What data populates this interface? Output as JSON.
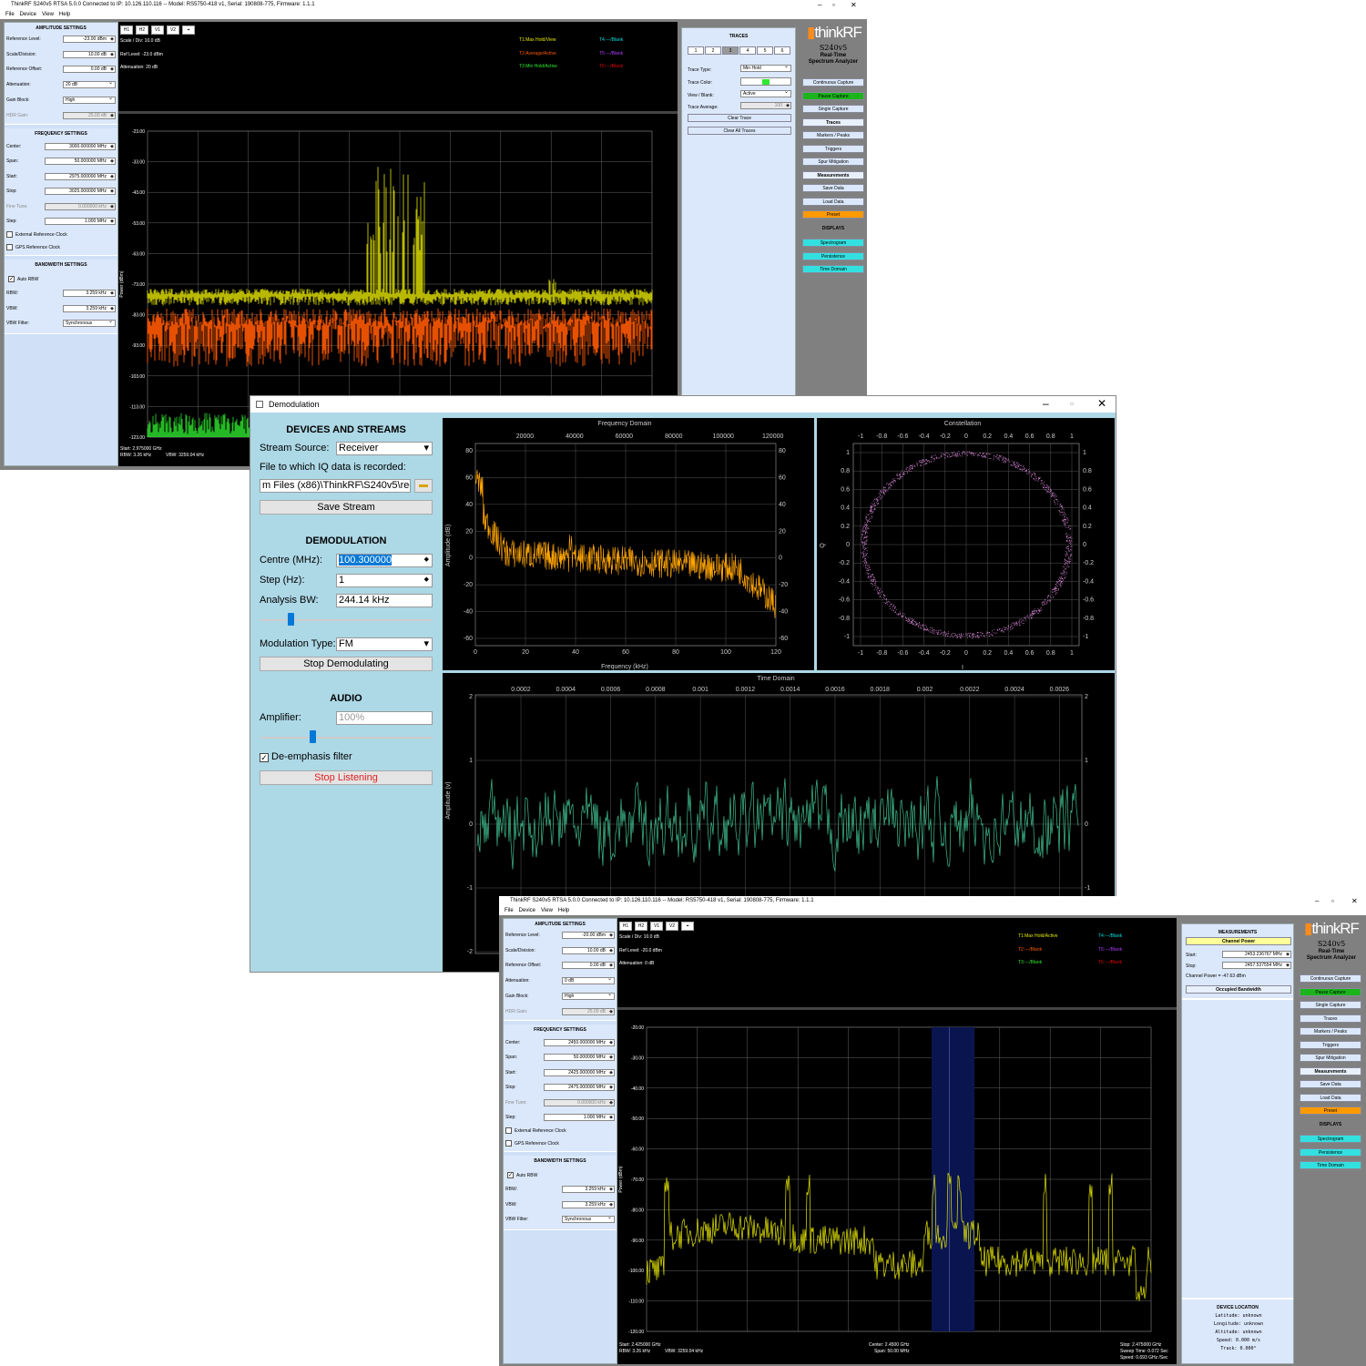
{
  "win1": {
    "title": "ThinkRF S240v5 RTSA 5.0.0 Connected to IP: 10.126.110.116 -- Model: RS5750-418 v1, Serial: 190808-775, Firmware: 1.1.1",
    "menu": [
      "File",
      "Device",
      "View",
      "Help"
    ],
    "amp": {
      "title": "AMPLITUDE SETTINGS",
      "ref_label": "Reference Level:",
      "ref": "-23.00 dBm",
      "scale_label": "Scale/Division:",
      "scale": "10.00 dB",
      "offset_label": "Reference Offset:",
      "offset": "0.00 dB",
      "att_label": "Attenuation:",
      "att": "20 dB",
      "gain_label": "Gain Block:",
      "gain": "High",
      "hdr_label": "HDR Gain:",
      "hdr": "25.00 dB"
    },
    "freq": {
      "title": "FREQUENCY SETTINGS",
      "center_label": "Center:",
      "center": "3000.000000 MHz",
      "span_label": "Span:",
      "span": "50.000000 MHz",
      "start_label": "Start:",
      "start": "2975.000000 MHz",
      "stop_label": "Stop:",
      "stop": "3025.000000 MHz",
      "fine_label": "Fine Tune:",
      "fine": "0.000000 kHz",
      "step_label": "Step:",
      "step": "1.000 MHz",
      "ext_clock": "External Reference Clock",
      "gps_clock": "GPS Reference Clock"
    },
    "bw": {
      "title": "BANDWIDTH SETTINGS",
      "auto": "Auto RBW",
      "rbw_label": "RBW:",
      "rbw": "3.259 kHz",
      "vbw_label": "VBW:",
      "vbw": "3.259 kHz",
      "filter_label": "VBW Filter:",
      "filter": "Synchronous"
    },
    "topbtns": [
      "H1",
      "H2",
      "V1",
      "V2",
      "⌖"
    ],
    "info": {
      "scale": "Scale / Div: 10.0 dB",
      "ref": "Ref Level: -23.0 dBm",
      "att": "Attenuation: 20 dB"
    },
    "legend": {
      "t1": "T1:Max Hold/View",
      "t2": "T2:Average/Active",
      "t3": "T3:Min Hold/Active",
      "t4": "T4:---/Blank",
      "t5": "T5:---/Blank",
      "t6": "T6:---/Blank"
    },
    "yticks": [
      "-23.00",
      "-33.00",
      "-43.00",
      "-53.00",
      "-63.00",
      "-73.00",
      "-83.00",
      "-93.00",
      "-103.00",
      "-113.00",
      "-123.00"
    ],
    "ylabel": "Power (dBm)",
    "footer": {
      "start": "Start: 2.975000 GHz",
      "rbw": "RBW: 3.26 kHz",
      "vbw": "VBW: 3259.04 kHz"
    },
    "traces": {
      "title": "TRACES",
      "tabs": [
        "1",
        "2",
        "3",
        "4",
        "5",
        "6"
      ],
      "type_label": "Trace Type:",
      "type": "Min Hold",
      "color_label": "Trace Color:",
      "view_label": "View / Blank:",
      "view": "Active",
      "avg_label": "Trace Average:",
      "avg": "100",
      "clear": "Clear Trace",
      "clear_all": "Clear All Traces"
    },
    "brand": {
      "logo": "thinkRF",
      "model": "S240v5",
      "sub1": "Real-Time",
      "sub2": "Spectrum Analyzer"
    },
    "side": [
      "Continuous Capture",
      "Pause Capture",
      "Single Capture",
      "Traces",
      "Markers / Peaks",
      "Triggers",
      "Spur Mitigation",
      "Measurements",
      "Save Data",
      "Load Data",
      "Preset"
    ],
    "displays_title": "DISPLAYS",
    "displays": [
      "Spectrogram",
      "Persistence",
      "Time Domain"
    ]
  },
  "demod": {
    "title": "Demodulation",
    "dev_title": "DEVICES AND STREAMS",
    "stream_label": "Stream Source:",
    "stream": "Receiver",
    "file_label": "File to which IQ data is recorded:",
    "file": "m Files (x86)\\ThinkRF\\S240v5\\recordings",
    "save": "Save Stream",
    "demod_title": "DEMODULATION",
    "centre_label": "Centre (MHz):",
    "centre": "100.300000",
    "step_label": "Step (Hz):",
    "step": "1",
    "abw_label": "Analysis BW:",
    "abw": "244.14 kHz",
    "mod_label": "Modulation Type:",
    "mod": "FM",
    "stop_demod": "Stop Demodulating",
    "audio_title": "AUDIO",
    "amp_label": "Amplifier:",
    "amp": "100%",
    "deemph": "De-emphasis filter",
    "stop_listen": "Stop Listening",
    "fd": {
      "title": "Frequency Domain",
      "xlabel": "Frequency (kHz)",
      "ylabel": "Amplitude (dB)",
      "top": [
        "20000",
        "40000",
        "60000",
        "80000",
        "100000",
        "120000"
      ],
      "bottom": [
        "0",
        "20",
        "40",
        "60",
        "80",
        "100",
        "120"
      ],
      "left": [
        "80",
        "60",
        "40",
        "20",
        "0",
        "-20",
        "-40",
        "-60"
      ],
      "right": [
        "80",
        "60",
        "40",
        "20",
        "0",
        "-20",
        "-40",
        "-60"
      ]
    },
    "con": {
      "title": "Constellation",
      "xlabel": "I",
      "ylabel": "Q",
      "x": [
        "-1",
        "-0.8",
        "-0.6",
        "-0.4",
        "-0.2",
        "0",
        "0.2",
        "0.4",
        "0.6",
        "0.8",
        "1"
      ],
      "y": [
        "1",
        "0.8",
        "0.6",
        "0.4",
        "0.2",
        "0",
        "-0.2",
        "-0.4",
        "-0.6",
        "-0.8",
        "-1"
      ]
    },
    "td": {
      "title": "Time Domain",
      "ylabel": "Amplitude (v)",
      "x": [
        "0.0002",
        "0.0004",
        "0.0006",
        "0.0008",
        "0.001",
        "0.0012",
        "0.0014",
        "0.0016",
        "0.0018",
        "0.002",
        "0.0022",
        "0.0024",
        "0.0026"
      ],
      "y": [
        "2",
        "1",
        "0",
        "-1",
        "-2"
      ]
    }
  },
  "win3": {
    "title": "ThinkRF S240v5 RTSA 5.0.0 Connected to IP: 10.126.110.116 -- Model: RS5750-418 v1, Serial: 190808-775, Firmware: 1.1.1",
    "menu": [
      "File",
      "Device",
      "View",
      "Help"
    ],
    "amp": {
      "title": "AMPLITUDE SETTINGS",
      "ref_label": "Reference Level:",
      "ref": "-20.00 dBm",
      "scale_label": "Scale/Division:",
      "scale": "10.00 dB",
      "offset_label": "Reference Offset:",
      "offset": "0.00 dB",
      "att_label": "Attenuation:",
      "att": "0 dB",
      "gain_label": "Gain Block:",
      "gain": "High",
      "hdr_label": "HDR Gain:",
      "hdr": "25.00 dB"
    },
    "freq": {
      "title": "FREQUENCY SETTINGS",
      "center_label": "Center:",
      "center": "2450.000000 MHz",
      "span_label": "Span:",
      "span": "50.000000 MHz",
      "start_label": "Start:",
      "start": "2425.000000 MHz",
      "stop_label": "Stop:",
      "stop": "2475.000000 MHz",
      "fine_label": "Fine Tune:",
      "fine": "0.000000 kHz",
      "step_label": "Step:",
      "step": "1.000 MHz",
      "ext_clock": "External Reference Clock",
      "gps_clock": "GPS Reference Clock"
    },
    "bw": {
      "title": "BANDWIDTH SETTINGS",
      "auto": "Auto RBW",
      "rbw_label": "RBW:",
      "rbw": "3.259 kHz",
      "vbw_label": "VBW:",
      "vbw": "3.259 kHz",
      "filter_label": "VBW Filter:",
      "filter": "Synchronous"
    },
    "info": {
      "scale": "Scale / Div: 10.0 dB",
      "ref": "Ref Level: -20.0 dBm",
      "att": "Attenuation: 0 dB"
    },
    "legend": {
      "t1": "T1:Max Hold/Active",
      "t2": "T2:---/Blank",
      "t3": "T3:---/Blank",
      "t4": "T4:---/Blank",
      "t5": "T5:---/Blank",
      "t6": "T6:---/Blank"
    },
    "yticks": [
      "-20.00",
      "-30.00",
      "-40.00",
      "-50.00",
      "-60.00",
      "-70.00",
      "-80.00",
      "-90.00",
      "-100.00",
      "-110.00",
      "-120.00"
    ],
    "ylabel": "Power (dBm)",
    "footer": {
      "start": "Start: 2.425000 GHz",
      "rbw": "RBW: 3.26 kHz",
      "vbw": "VBW: 3259.04 kHz",
      "center": "Center: 2.4500 GHz",
      "span": "Span: 50.00 MHz",
      "stop": "Stop: 2.475000 GHz",
      "sweep": "Sweep Time: 0.072 Sec",
      "speed": "Speed: 0.693 GHz /Sec"
    },
    "meas": {
      "title": "MEASUREMENTS",
      "cp": "Channel Power",
      "start_label": "Start:",
      "start": "2453.236767 MHz",
      "stop_label": "Stop:",
      "stop": "2457.537554 MHz",
      "power": "Channel Power = -47.63 dBm",
      "obw": "Occupied Bandwidth"
    },
    "loc": {
      "title": "DEVICE LOCATION",
      "lat": "Latitude: unknown",
      "lon": "Longitude: unknown",
      "alt": "Altitude: unknown",
      "speed": "Speed: 0.000 m/s",
      "track": "Track: 0.000°"
    }
  },
  "colors": {
    "yellow": "#e6e600",
    "orange": "#ff5a00",
    "green": "#2fe82f",
    "fd": "#ffa500",
    "con": "#e08be0",
    "td": "#3fbf8f",
    "panel": "#cfe0f7",
    "demodbg": "#add8e6"
  }
}
